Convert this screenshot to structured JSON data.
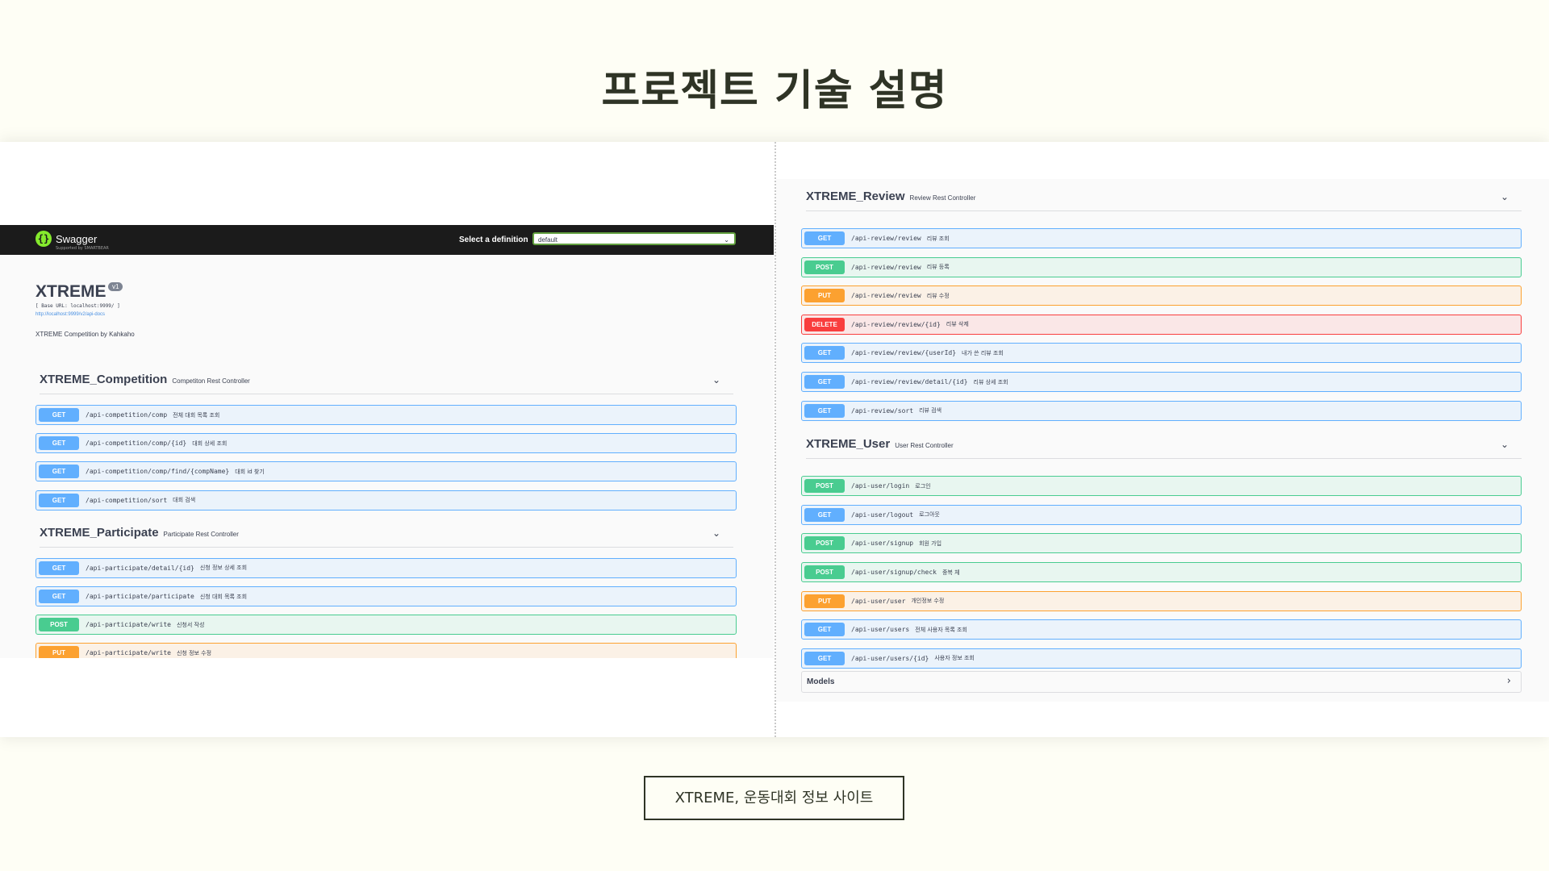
{
  "slide": {
    "title": "프로젝트 기술 설명",
    "caption": "XTREME, 운동대회 정보 사이트"
  },
  "swagger": {
    "logo_text": "Swagger",
    "logo_sub": "Supported by SMARTBEAR",
    "definition_label": "Select a definition",
    "definition_value": "default",
    "api_title": "XTREME",
    "version": "v1",
    "base_url": "[ Base URL: localhost:9999/ ]",
    "docs_link": "http://localhost:9999/v2/api-docs",
    "description": "XTREME Competition by Kahkaho",
    "models_label": "Models"
  },
  "colors": {
    "get": "#61affe",
    "post": "#49cc90",
    "put": "#fca130",
    "delete": "#f93e3e",
    "topbar": "#1b1b1b"
  },
  "left_tags": [
    {
      "name": "XTREME_Competition",
      "desc": "Competiton Rest Controller",
      "ops": [
        {
          "method": "GET",
          "path": "/api-competition/comp",
          "summary": "전체 대회 목록 조회"
        },
        {
          "method": "GET",
          "path": "/api-competition/comp/{id}",
          "summary": "대회 상세 조회"
        },
        {
          "method": "GET",
          "path": "/api-competition/comp/find/{compName}",
          "summary": "대회 id 찾기"
        },
        {
          "method": "GET",
          "path": "/api-competition/sort",
          "summary": "대회 검색"
        }
      ]
    },
    {
      "name": "XTREME_Participate",
      "desc": "Participate Rest Controller",
      "ops": [
        {
          "method": "GET",
          "path": "/api-participate/detail/{id}",
          "summary": "신청 정보 상세 조회"
        },
        {
          "method": "GET",
          "path": "/api-participate/participate",
          "summary": "신청 대회 목록 조회"
        },
        {
          "method": "POST",
          "path": "/api-participate/write",
          "summary": "신청서 작성"
        },
        {
          "method": "PUT",
          "path": "/api-participate/write",
          "summary": "신청 정보 수정"
        }
      ]
    }
  ],
  "right_tags": [
    {
      "name": "XTREME_Review",
      "desc": "Review Rest Controller",
      "ops": [
        {
          "method": "GET",
          "path": "/api-review/review",
          "summary": "리뷰 조회"
        },
        {
          "method": "POST",
          "path": "/api-review/review",
          "summary": "리뷰 등록"
        },
        {
          "method": "PUT",
          "path": "/api-review/review",
          "summary": "리뷰 수정"
        },
        {
          "method": "DELETE",
          "path": "/api-review/review/{id}",
          "summary": "리뷰 삭제"
        },
        {
          "method": "GET",
          "path": "/api-review/review/{userId}",
          "summary": "내가 쓴 리뷰 조회"
        },
        {
          "method": "GET",
          "path": "/api-review/review/detail/{id}",
          "summary": "리뷰 상세 조회"
        },
        {
          "method": "GET",
          "path": "/api-review/sort",
          "summary": "리뷰 검색"
        }
      ]
    },
    {
      "name": "XTREME_User",
      "desc": "User Rest Controller",
      "ops": [
        {
          "method": "POST",
          "path": "/api-user/login",
          "summary": "로그인"
        },
        {
          "method": "GET",
          "path": "/api-user/logout",
          "summary": "로그아웃"
        },
        {
          "method": "POST",
          "path": "/api-user/signup",
          "summary": "회원 가입"
        },
        {
          "method": "POST",
          "path": "/api-user/signup/check",
          "summary": "중복 체"
        },
        {
          "method": "PUT",
          "path": "/api-user/user",
          "summary": "개인정보 수정"
        },
        {
          "method": "GET",
          "path": "/api-user/users",
          "summary": "전체 사용자 목록 조회"
        },
        {
          "method": "GET",
          "path": "/api-user/users/{id}",
          "summary": "사용자 정보 조회"
        }
      ]
    }
  ]
}
